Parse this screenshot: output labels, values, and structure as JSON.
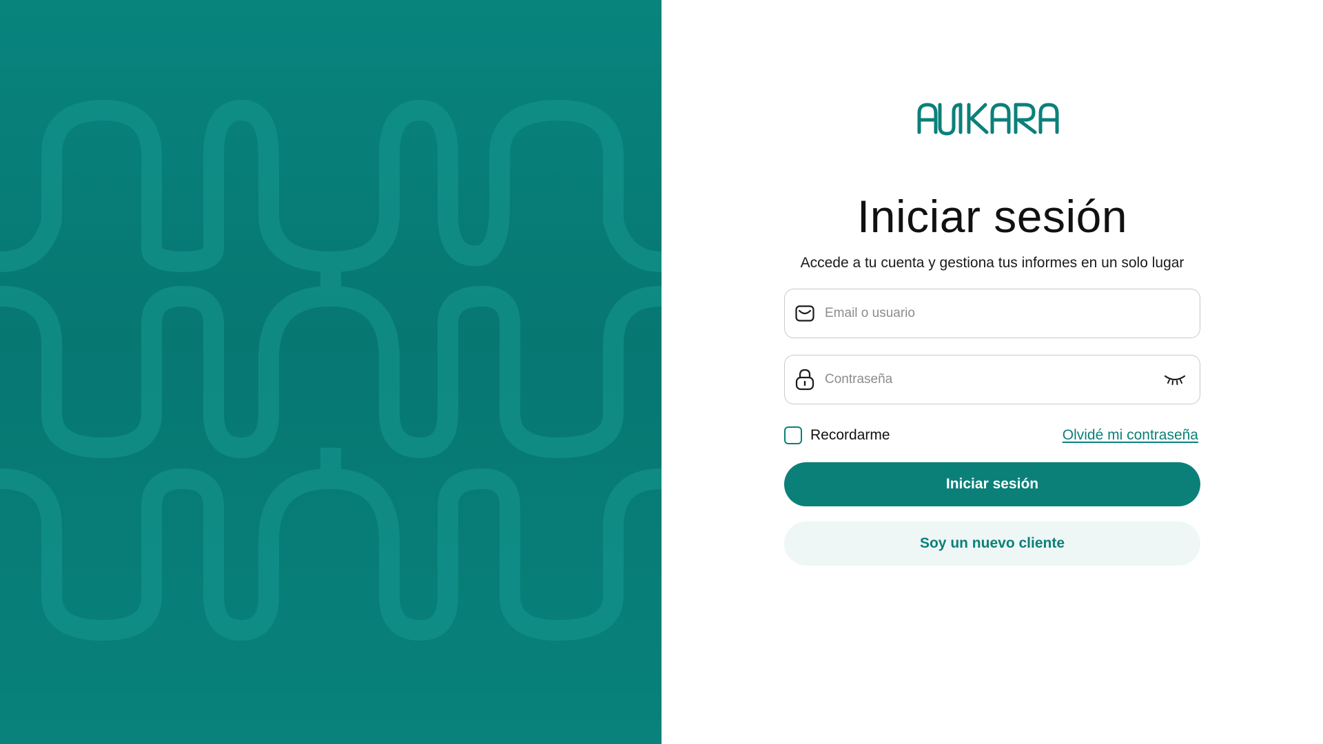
{
  "brand": {
    "logo_text": "ANKARA",
    "primary_color": "#0b8079",
    "panel_color": "#077a74",
    "secondary_bg": "#eef7f5"
  },
  "login": {
    "title": "Iniciar sesión",
    "subtitle": "Accede a tu cuenta y gestiona tus informes en un solo lugar",
    "email": {
      "placeholder": "Email o usuario",
      "value": "",
      "icon": "mail-icon"
    },
    "password": {
      "placeholder": "Contraseña",
      "value": "",
      "icon": "lock-icon",
      "toggle_icon": "eye-closed-icon"
    },
    "remember_label": "Recordarme",
    "remember_checked": false,
    "forgot_label": "Olvidé mi contraseña",
    "submit_label": "Iniciar sesión",
    "new_client_label": "Soy un nuevo cliente"
  }
}
